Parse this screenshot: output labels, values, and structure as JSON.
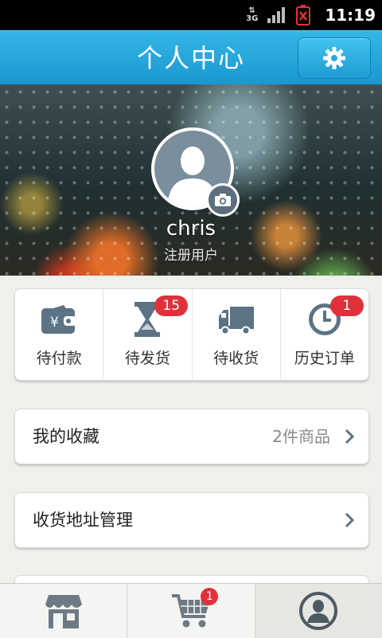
{
  "status_bar": {
    "network": "3G",
    "time": "11:19"
  },
  "header": {
    "title": "个人中心",
    "settings_icon": "gear-icon"
  },
  "profile": {
    "username": "chris",
    "user_type": "注册用户",
    "avatar_icon": "person-silhouette-icon",
    "camera_icon": "camera-icon"
  },
  "orders": [
    {
      "label": "待付款",
      "icon": "wallet-icon",
      "badge": null
    },
    {
      "label": "待发货",
      "icon": "hourglass-icon",
      "badge": "15"
    },
    {
      "label": "待收货",
      "icon": "truck-icon",
      "badge": null
    },
    {
      "label": "历史订单",
      "icon": "clock-icon",
      "badge": "1"
    }
  ],
  "list": [
    {
      "label": "我的收藏",
      "value": "2件商品"
    },
    {
      "label": "收货地址管理",
      "value": ""
    }
  ],
  "bottom_nav": [
    {
      "icon": "store-icon",
      "badge": null
    },
    {
      "icon": "cart-icon",
      "badge": "1"
    },
    {
      "icon": "user-profile-icon",
      "badge": null,
      "active": true
    }
  ],
  "colors": {
    "header_blue": "#1a97cf",
    "badge_red": "#e0313a",
    "icon_slate": "#5b7384"
  }
}
